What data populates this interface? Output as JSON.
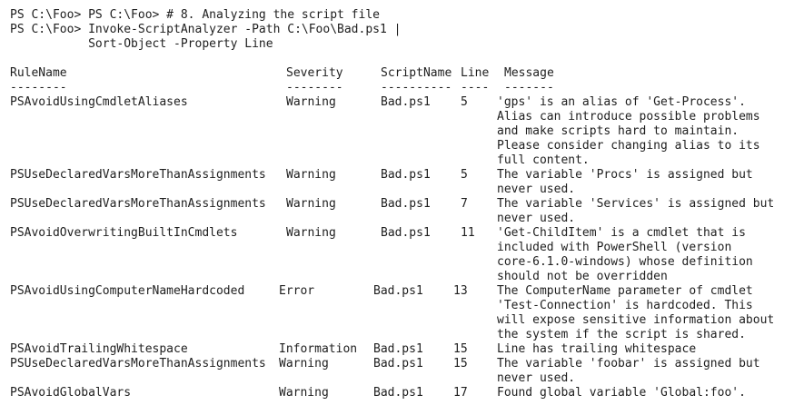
{
  "terminal": {
    "prompt_line_1": "PS C:\\Foo> PS C:\\Foo> # 8. Analyzing the script file",
    "prompt_line_2": "PS C:\\Foo> Invoke-ScriptAnalyzer -Path C:\\Foo\\Bad.ps1 |",
    "prompt_line_3": "           Sort-Object -Property Line"
  },
  "table": {
    "headers": {
      "rulename": "RuleName",
      "severity": "Severity",
      "scriptname": "ScriptName",
      "line": "Line",
      "message": "Message"
    },
    "underlines": {
      "rulename": "--------",
      "severity": "--------",
      "scriptname": "----------",
      "line": "----",
      "message": "-------"
    },
    "rows": [
      {
        "rule": "PSAvoidUsingCmdletAliases",
        "severity": "Warning",
        "script": "Bad.ps1",
        "line": "5",
        "message": [
          "'gps' is an alias of 'Get-Process'.",
          "Alias can introduce possible problems",
          "and make scripts hard to maintain.",
          "Please consider changing alias to its",
          "full content."
        ]
      },
      {
        "rule": "PSUseDeclaredVarsMoreThanAssignments",
        "severity": "Warning",
        "script": "Bad.ps1",
        "line": "5",
        "message": [
          "The variable 'Procs' is assigned but",
          "never used."
        ]
      },
      {
        "rule": "PSUseDeclaredVarsMoreThanAssignments",
        "severity": "Warning",
        "script": "Bad.ps1",
        "line": "7",
        "message": [
          "The variable 'Services' is assigned but",
          "never used."
        ]
      },
      {
        "rule": "PSAvoidOverwritingBuiltInCmdlets",
        "severity": "Warning",
        "script": "Bad.ps1",
        "line": "11",
        "message": [
          "'Get-ChildItem' is a cmdlet that is",
          "included with PowerShell (version",
          "core-6.1.0-windows) whose definition",
          "should not be overridden"
        ]
      },
      {
        "rule": "PSAvoidUsingComputerNameHardcoded",
        "severity": "Error",
        "script": "Bad.ps1",
        "line": "13",
        "message": [
          "The ComputerName parameter of cmdlet",
          "'Test-Connection' is hardcoded. This",
          "will expose sensitive information about",
          "the system if the script is shared."
        ]
      },
      {
        "rule": "PSAvoidTrailingWhitespace",
        "severity": "Information",
        "script": "Bad.ps1",
        "line": "15",
        "message": [
          "Line has trailing whitespace"
        ]
      },
      {
        "rule": "PSUseDeclaredVarsMoreThanAssignments",
        "severity": "Warning",
        "script": "Bad.ps1",
        "line": "15",
        "message": [
          "The variable 'foobar' is assigned but",
          "never used."
        ]
      },
      {
        "rule": "PSAvoidGlobalVars",
        "severity": "Warning",
        "script": "Bad.ps1",
        "line": "17",
        "message": [
          "Found global variable 'Global:foo'."
        ]
      }
    ]
  }
}
